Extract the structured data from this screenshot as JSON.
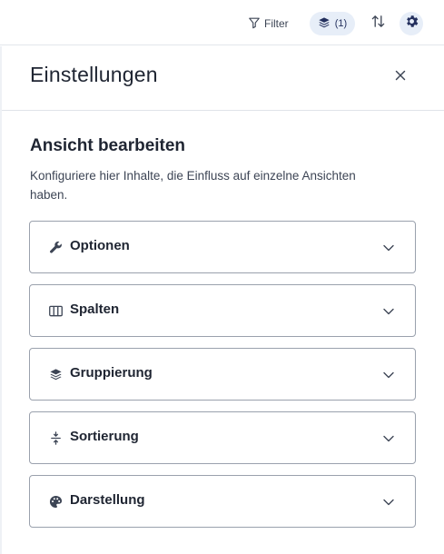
{
  "toolbar": {
    "filter_label": "Filter",
    "layers_count": "(1)",
    "filter_icon": "filter-icon",
    "layers_icon": "layers-icon",
    "sort_icon": "sort-arrows-icon",
    "settings_icon": "gear-icon"
  },
  "panel": {
    "title": "Einstellungen",
    "close_icon": "close-icon",
    "section_title": "Ansicht bearbeiten",
    "section_description": "Konfiguriere hier Inhalte, die Einfluss auf einzelne Ansichten haben.",
    "accordions": [
      {
        "label": "Optionen",
        "icon": "wrench-icon"
      },
      {
        "label": "Spalten",
        "icon": "columns-icon"
      },
      {
        "label": "Gruppierung",
        "icon": "layers-icon"
      },
      {
        "label": "Sortierung",
        "icon": "sort-icon"
      },
      {
        "label": "Darstellung",
        "icon": "palette-icon"
      }
    ]
  },
  "colors": {
    "accent": "#24305e",
    "pill_bg": "#e7eef8",
    "border": "#9aa1ad",
    "text": "#1f2532"
  }
}
